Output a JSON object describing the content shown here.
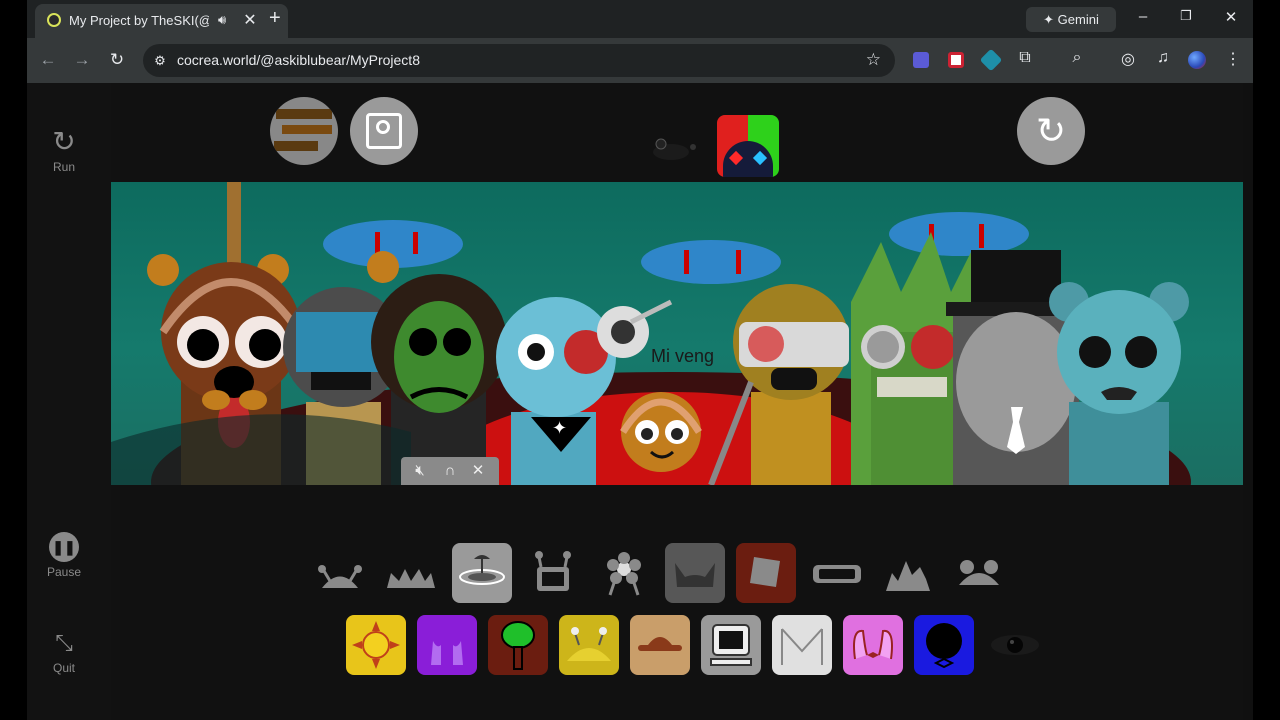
{
  "browser": {
    "tab_title": "My Project by TheSKI(@askiblubear)",
    "new_tab_label": "+",
    "gemini_label": "✦ Gemini",
    "url": "cocrea.world/@askiblubear/MyProject8"
  },
  "sidebar": {
    "run_label": "Run",
    "pause_label": "Pause",
    "quit_label": "Quit"
  },
  "scene": {
    "overlay_text": "Mi veng"
  },
  "colors": {
    "scene_bg": "#137265",
    "blood_red": "#cc1010",
    "cloud_blue": "#2f86c9"
  },
  "icons_row1": [
    "antenna-dome-icon",
    "spiky-hair-icon",
    "ufo-icon",
    "tv-head-icon",
    "flower-icon",
    "cat-ears-icon",
    "bucket-hat-icon",
    "visor-icon",
    "crown-spikes-icon",
    "bear-ears-icon"
  ],
  "icons_row2": [
    "sun-icon",
    "purple-horns-icon",
    "tree-icon",
    "yellow-antenna-icon",
    "brown-hat-icon",
    "computer-icon",
    "envelope-icon",
    "pink-bow-icon",
    "blue-bow-icon",
    "dark-eye-icon"
  ]
}
